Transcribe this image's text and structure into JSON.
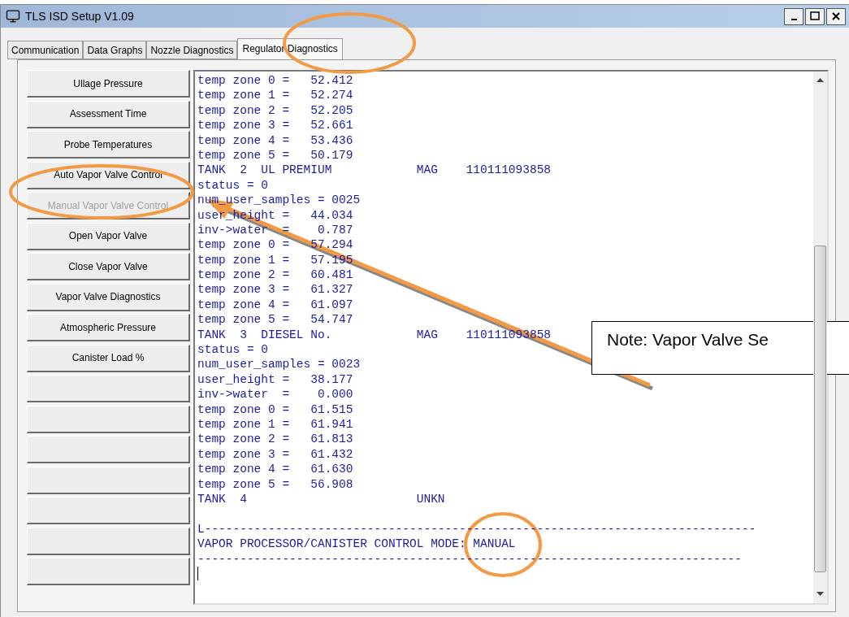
{
  "window": {
    "title": "TLS ISD Setup V1.09"
  },
  "tabs": [
    {
      "label": "Communication",
      "selected": false
    },
    {
      "label": "Data Graphs",
      "selected": false
    },
    {
      "label": "Nozzle Diagnostics",
      "selected": false
    },
    {
      "label": "Regulator Diagnostics",
      "selected": true
    }
  ],
  "side_buttons": [
    {
      "kind": "command",
      "label": "Ullage Pressure",
      "disabled": false
    },
    {
      "kind": "command",
      "label": "Assessment Time",
      "disabled": false
    },
    {
      "kind": "command",
      "label": "Probe Temperatures",
      "disabled": false
    },
    {
      "kind": "command",
      "label": "Auto Vapor Valve Control",
      "disabled": false
    },
    {
      "kind": "command",
      "label": "Manual Vapor Valve Control",
      "disabled": true
    },
    {
      "kind": "command",
      "label": "Open Vapor Valve",
      "disabled": false
    },
    {
      "kind": "command",
      "label": "Close Vapor Valve",
      "disabled": false
    },
    {
      "kind": "command",
      "label": "Vapor Valve Diagnostics",
      "disabled": false
    },
    {
      "kind": "command",
      "label": "Atmospheric Pressure",
      "disabled": false
    },
    {
      "kind": "command",
      "label": "Canister Load %",
      "disabled": false
    },
    {
      "kind": "blank"
    },
    {
      "kind": "blank"
    },
    {
      "kind": "blank"
    },
    {
      "kind": "blank"
    },
    {
      "kind": "blank"
    },
    {
      "kind": "blank"
    },
    {
      "kind": "blank"
    }
  ],
  "log_lines": [
    "temp zone 0 =   52.412",
    "temp zone 1 =   52.274",
    "temp zone 2 =   52.205",
    "temp zone 3 =   52.661",
    "temp zone 4 =   53.436",
    "temp zone 5 =   50.179",
    "TANK  2  UL PREMIUM            MAG    110111093858",
    "status = 0",
    "num_user_samples = 0025",
    "user_height =   44.034",
    "inv->water  =    0.787",
    "temp zone 0 =   57.294",
    "temp zone 1 =   57.195",
    "temp zone 2 =   60.481",
    "temp zone 3 =   61.327",
    "temp zone 4 =   61.097",
    "temp zone 5 =   54.747",
    "TANK  3  DIESEL No.            MAG    110111093858",
    "status = 0",
    "num_user_samples = 0023",
    "user_height =   38.177",
    "inv->water  =    0.000",
    "temp zone 0 =   61.515",
    "temp zone 1 =   61.941",
    "temp zone 2 =   61.813",
    "temp zone 3 =   61.432",
    "temp zone 4 =   61.630",
    "temp zone 5 =   56.908",
    "TANK  4                        UNKN"
  ],
  "mode_lines": [
    "L------------------------------------------------------------------------------",
    "VAPOR PROCESSOR/CANISTER CONTROL MODE: MANUAL",
    "-----------------------------------------------------------------------------"
  ],
  "note": {
    "text": "Note: Vapor Valve Se"
  }
}
